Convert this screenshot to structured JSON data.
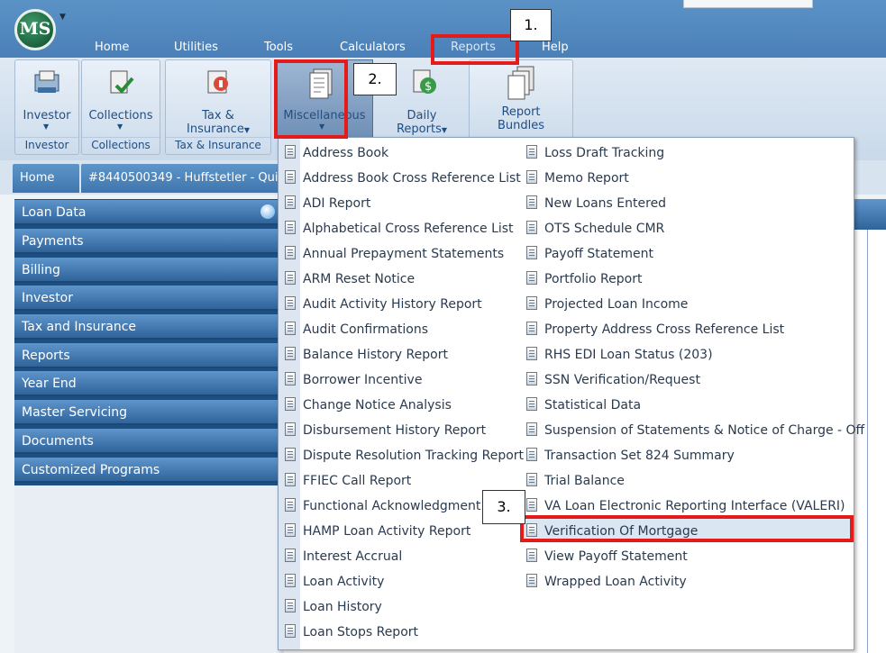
{
  "app": {
    "logo_text": "MS",
    "menu_tabs": [
      "Home",
      "Utilities",
      "Tools",
      "Calculators",
      "Reports",
      "Help"
    ]
  },
  "ribbon": {
    "buttons": {
      "investor": "Investor",
      "collections": "Collections",
      "tax_line1": "Tax &",
      "tax_line2": "Insurance",
      "misc": "Miscellaneous",
      "daily_line1": "Daily",
      "daily_line2": "Reports",
      "bundles_line1": "Report",
      "bundles_line2": "Bundles"
    },
    "groups": {
      "investor": "Investor",
      "collections": "Collections",
      "tax": "Tax & Insurance"
    }
  },
  "doc_tabs": {
    "home": "Home",
    "loan": "#8440500349 - Huffstetler - Qui"
  },
  "nav_items": [
    "Loan Data",
    "Payments",
    "Billing",
    "Investor",
    "Tax and Insurance",
    "Reports",
    "Year End",
    "Master Servicing",
    "Documents",
    "Customized Programs"
  ],
  "menu": {
    "col1": [
      "Address Book",
      "Address Book Cross Reference List",
      "ADI Report",
      "Alphabetical Cross Reference List",
      "Annual Prepayment Statements",
      "ARM Reset Notice",
      "Audit Activity History Report",
      "Audit Confirmations",
      "Balance History Report",
      "Borrower Incentive",
      "Change Notice Analysis",
      "Disbursement History Report",
      "Dispute Resolution Tracking Report",
      "FFIEC Call Report",
      "Functional Acknowledgment",
      "HAMP Loan Activity Report",
      "Interest Accrual",
      "Loan Activity",
      "Loan History",
      "Loan Stops Report"
    ],
    "col2": [
      "Loss Draft Tracking",
      "Memo Report",
      "New Loans Entered",
      "OTS Schedule CMR",
      "Payoff Statement",
      "Portfolio Report",
      "Projected Loan Income",
      "Property Address Cross Reference List",
      "RHS EDI Loan Status (203)",
      "SSN Verification/Request",
      "Statistical Data",
      "Suspension of Statements & Notice of Charge - Off",
      "Transaction Set 824 Summary",
      "Trial Balance",
      "VA Loan Electronic Reporting Interface (VALERI)",
      "Verification Of Mortgage",
      "View Payoff Statement",
      "Wrapped Loan Activity"
    ]
  },
  "callouts": {
    "step1": "1.",
    "step2": "2.",
    "step3": "3."
  },
  "colors": {
    "highlight_red": "#e31b1b",
    "ribbon_blue": "#4a80b7",
    "nav_blue": "#3f76ad"
  }
}
